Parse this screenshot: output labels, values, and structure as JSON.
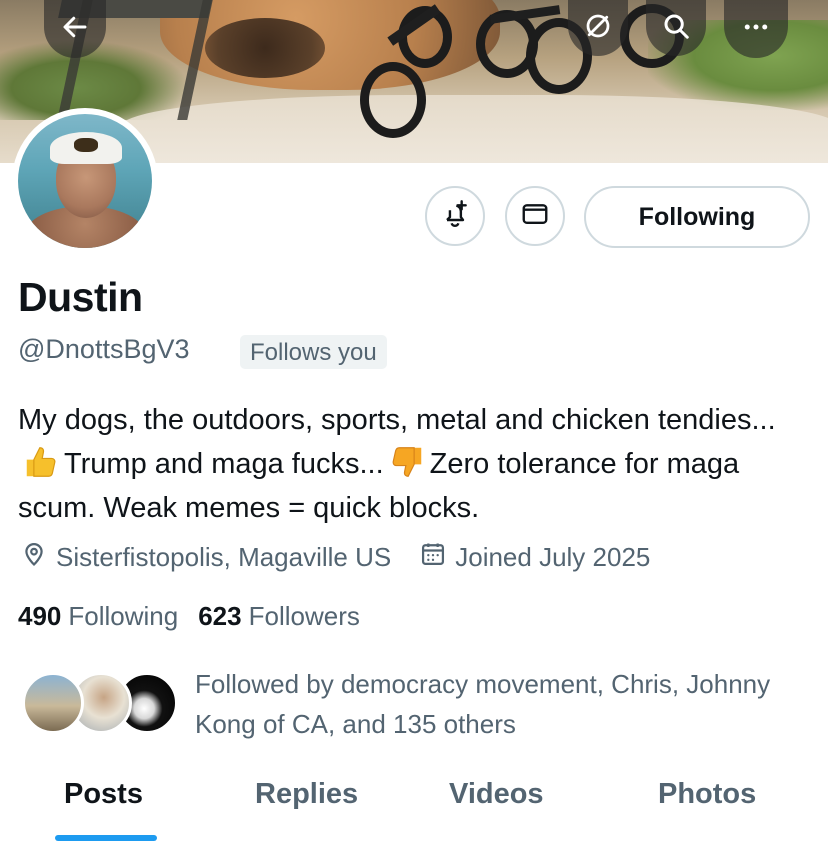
{
  "header": {
    "back_icon": "arrow-left-icon",
    "sync_icon": "sync-icon",
    "search_icon": "search-icon",
    "more_icon": "more-horizontal-icon"
  },
  "actions": {
    "notify_icon": "bell-plus-icon",
    "message_icon": "mail-icon",
    "follow_label": "Following"
  },
  "profile": {
    "name": "Dustin",
    "handle": "@DnottsBgV3",
    "follows_you": "Follows you",
    "bio_part1": "My dogs, the outdoors, sports, metal and chicken tendies...",
    "bio_emoji1": "thumbs-up",
    "bio_part2": "Trump and maga fucks...",
    "bio_emoji2": "thumbs-down",
    "bio_part3": "Zero tolerance for maga scum. Weak memes = quick blocks.",
    "location": "Sisterfistopolis, Magaville US",
    "joined": "Joined July 2025"
  },
  "stats": {
    "following_count": "490",
    "following_label": "Following",
    "followers_count": "623",
    "followers_label": "Followers"
  },
  "followed_by": {
    "text": "Followed by democracy movement, Chris, Johnny Kong of CA, and 135 others"
  },
  "tabs": [
    {
      "label": "Posts",
      "active": true
    },
    {
      "label": "Replies",
      "active": false
    },
    {
      "label": "Videos",
      "active": false
    },
    {
      "label": "Photos",
      "active": false
    }
  ],
  "colors": {
    "accent": "#1d9bf0",
    "text_primary": "#0f1419",
    "text_secondary": "#536471",
    "border": "#cfd9de"
  }
}
